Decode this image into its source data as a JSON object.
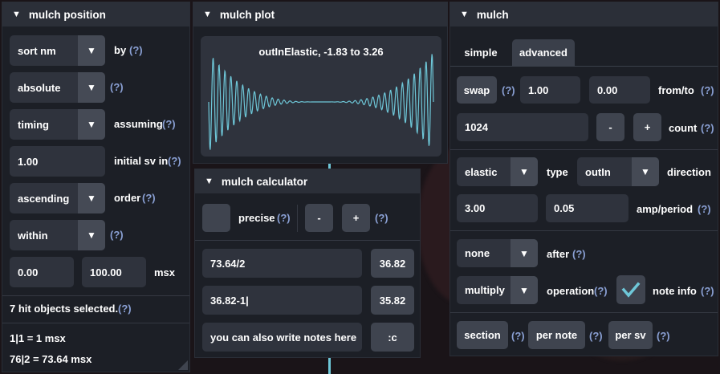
{
  "colors": {
    "accent": "#6ec7d8",
    "help": "#8aa0d4",
    "panel": "#1c1f26",
    "header": "#2b2f38"
  },
  "position": {
    "title": "mulch position",
    "sort_value": "sort nm",
    "sort_label": "by",
    "sort_help": "(?)",
    "mode_value": "absolute",
    "mode_help": "(?)",
    "assume_value": "timing",
    "assume_label": "assuming",
    "assume_help": "(?)",
    "initial_sv": "1.00",
    "initial_sv_label": "initial sv in",
    "initial_sv_help": "(?)",
    "order_value": "ascending",
    "order_label": "order",
    "order_help": "(?)",
    "within_value": "within",
    "within_help": "(?)",
    "range_from": "0.00",
    "range_to": "100.00",
    "range_unit": "msx",
    "selected_text": "7 hit objects selected.",
    "selected_help": "(?)",
    "info_line1": "1|1 = 1 msx",
    "info_line2": "76|2 = 73.64 msx"
  },
  "plot": {
    "title": "mulch plot",
    "caption": "outInElastic, -1.83 to 3.26"
  },
  "calculator": {
    "title": "mulch calculator",
    "precise_label": "precise",
    "precise_help": "(?)",
    "minus": "-",
    "plus": "+",
    "pm_help": "(?)",
    "rows": [
      {
        "expr": "73.64/2",
        "result": "36.82"
      },
      {
        "expr": "36.82-1|",
        "result": "35.82"
      },
      {
        "expr": "you can also write notes here",
        "result": ":c"
      }
    ]
  },
  "mulch": {
    "title": "mulch",
    "tab_simple": "simple",
    "tab_advanced": "advanced",
    "swap": "swap",
    "swap_help": "(?)",
    "from": "1.00",
    "to": "0.00",
    "fromto_label": "from/to",
    "fromto_help": "(?)",
    "count": "1024",
    "count_minus": "-",
    "count_plus": "+",
    "count_label": "count",
    "count_help": "(?)",
    "type_value": "elastic",
    "type_label": "type",
    "direction_value": "outIn",
    "direction_label": "direction",
    "amp": "3.00",
    "period": "0.05",
    "amp_label": "amp/period",
    "amp_help": "(?)",
    "after_value": "none",
    "after_label": "after",
    "after_help": "(?)",
    "operation_value": "multiply",
    "operation_label": "operation",
    "operation_help": "(?)",
    "noteinfo_label": "note info",
    "noteinfo_help": "(?)",
    "section": "section",
    "section_help": "(?)",
    "per_note": "per note",
    "per_note_help": "(?)",
    "per_sv": "per sv",
    "per_sv_help": "(?)"
  }
}
